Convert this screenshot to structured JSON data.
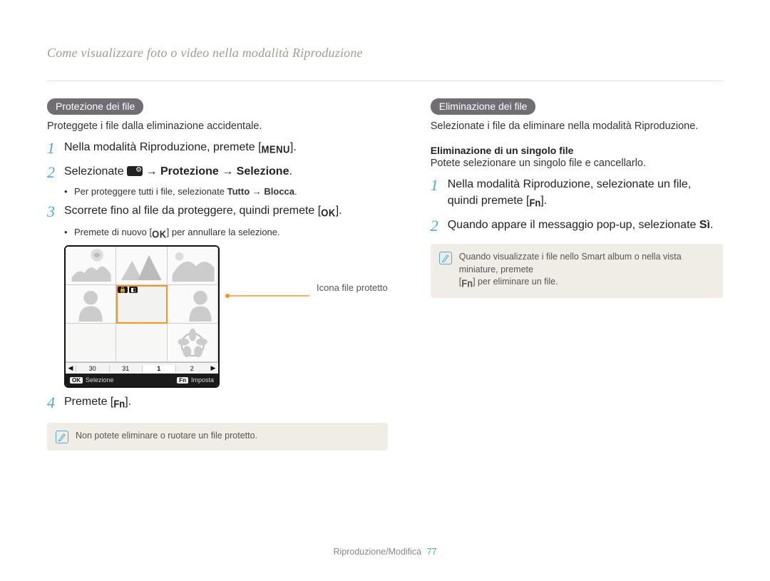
{
  "header": "Come visualizzare foto o video nella modalità Riproduzione",
  "left": {
    "pill": "Protezione dei file",
    "intro": "Proteggete i file dalla eliminazione accidentale.",
    "step1_pre": "Nella modalità Riproduzione, premete [",
    "step1_post": "].",
    "step2_pre": "Selezionate ",
    "step2_mid": " → ",
    "step2_b1": "Protezione",
    "step2_b2": "Selezione",
    "step2_post": ".",
    "sub2_pre": "Per proteggere tutti i file, selezionate ",
    "sub2_b1": "Tutto",
    "sub2_mid": " → ",
    "sub2_b2": "Blocca",
    "sub2_post": ".",
    "step3_pre": "Scorrete fino al file da proteggere, quindi premete [",
    "step3_post": "].",
    "sub3_pre": "Premete di nuovo [",
    "sub3_post": "] per annullare la selezione.",
    "callout": "Icona file protetto",
    "step4_pre": "Premete [",
    "step4_post": "].",
    "note": "Non potete eliminare o ruotare un file protetto.",
    "cal": {
      "c1": "30",
      "c2": "31",
      "c3": "1",
      "c4": "2"
    },
    "bb": {
      "k1": "OK",
      "t1": "Selezione",
      "k2": "Fn",
      "t2": "Imposta"
    }
  },
  "right": {
    "pill": "Eliminazione dei file",
    "intro": "Selezionate i file da eliminare nella modalità Riproduzione.",
    "sub_title": "Eliminazione di un singolo file",
    "sub_intro": "Potete selezionare un singolo file e cancellarlo.",
    "step1_pre": "Nella modalità Riproduzione, selezionate un file, quindi premete [",
    "step1_post": "].",
    "step2_pre": "Quando appare il messaggio pop-up, selezionate ",
    "step2_b": "Sì",
    "step2_post": ".",
    "note_l1": "Quando visualizzate i file nello Smart album o nella vista miniature, premete ",
    "note_l2_pre": "[",
    "note_l2_post": "] per eliminare un file."
  },
  "footer": {
    "section": "Riproduzione/Modifica",
    "page": "77"
  }
}
